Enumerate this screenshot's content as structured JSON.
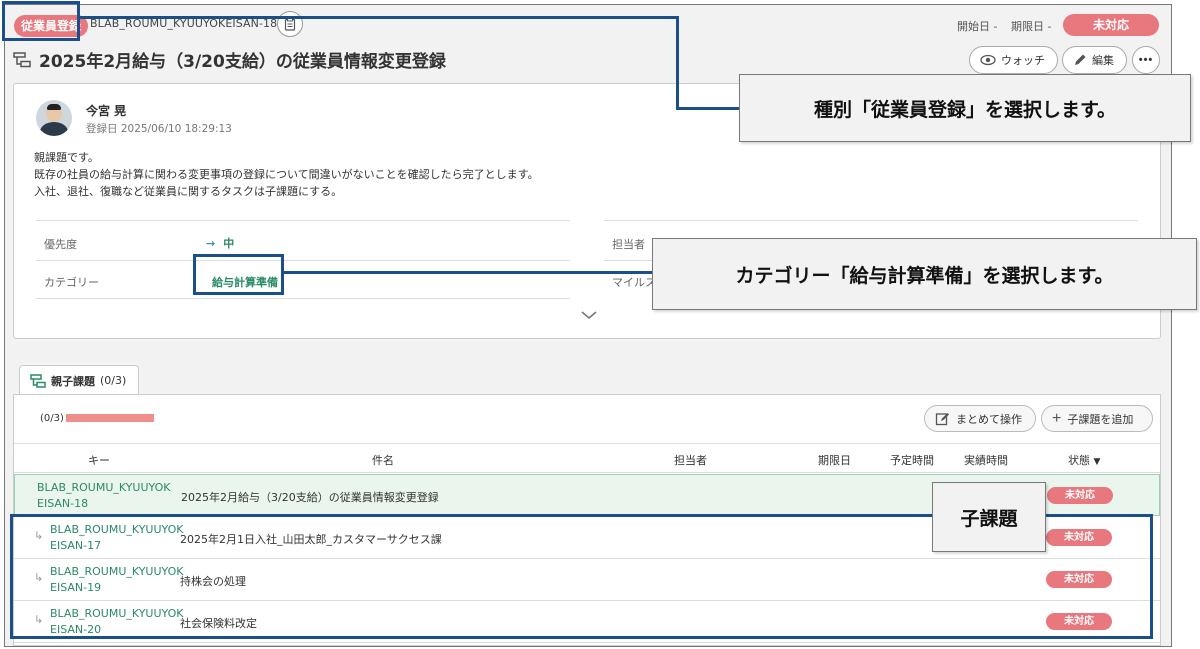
{
  "header": {
    "issue_type": "従業員登録",
    "issue_key": "BLAB_ROUMU_KYUUYOKEISAN-18",
    "start_date_label": "開始日 -",
    "due_date_label": "期限日 -",
    "status": "未対応",
    "title": "2025年2月給与（3/20支給）の従業員情報変更登録",
    "watch_label": "ウォッチ",
    "edit_label": "編集",
    "more_label": "•••"
  },
  "detail": {
    "author": "今宮 晃",
    "registered": "登録日  2025/06/10 18:29:13",
    "description": [
      "親課題です。",
      "既存の社員の給与計算に関わる変更事項の登録について間違いがないことを確認したら完了とします。",
      "入社、退社、復職など従業員に関するタスクは子課題にする。"
    ],
    "priority_label": "優先度",
    "priority_value": "中",
    "category_label": "カテゴリー",
    "category_value": "給与計算準備",
    "assignee_label": "担当者",
    "milestone_label": "マイルス"
  },
  "subtasks": {
    "tab_label": "親子課題",
    "tab_count": "(0/3)",
    "progress_text": "(0/3)",
    "progress_fraction": 0.0,
    "bulk_label": "まとめて操作",
    "add_label": "子課題を追加",
    "columns": [
      "キー",
      "件名",
      "担当者",
      "期限日",
      "予定時間",
      "実績時間",
      "状態"
    ],
    "parent": {
      "key": "BLAB_ROUMU_KYUUYOKEISAN-18",
      "summary": "2025年2月給与（3/20支給）の従業員情報変更登録",
      "status": "未対応"
    },
    "children": [
      {
        "key": "BLAB_ROUMU_KYUUYOKEISAN-17",
        "summary": "2025年2月1日入社_山田太郎_カスタマーサクセス課",
        "status": "未対応"
      },
      {
        "key": "BLAB_ROUMU_KYUUYOKEISAN-19",
        "summary": "持株会の処理",
        "status": "未対応"
      },
      {
        "key": "BLAB_ROUMU_KYUUYOKEISAN-20",
        "summary": "社会保険料改定",
        "status": "未対応"
      }
    ]
  },
  "annotations": {
    "type_callout": "種別「従業員登録」を選択します。",
    "category_callout": "カテゴリー「給与計算準備」を選択します。",
    "children_callout": "子課題"
  },
  "colors": {
    "accent_green": "#2a8a64",
    "status_red": "#e8787e",
    "annotation_blue": "#1b4f8a"
  }
}
